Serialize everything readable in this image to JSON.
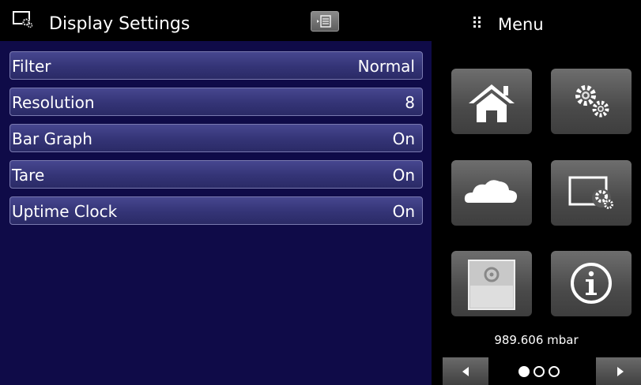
{
  "header": {
    "title": "Display Settings",
    "title_icon": "display-settings-icon",
    "collapse_icon": "collapse-panel-icon"
  },
  "settings": [
    {
      "label": "Filter",
      "value": "Normal"
    },
    {
      "label": "Resolution",
      "value": "8"
    },
    {
      "label": "Bar Graph",
      "value": "On"
    },
    {
      "label": "Tare",
      "value": "On"
    },
    {
      "label": "Uptime Clock",
      "value": "On"
    }
  ],
  "menu": {
    "title": "Menu",
    "grip_icon": "grip-icon",
    "tiles": [
      {
        "icon": "home-icon"
      },
      {
        "icon": "gears-icon"
      },
      {
        "icon": "cloud-icon"
      },
      {
        "icon": "display-settings-icon"
      },
      {
        "icon": "storage-icon"
      },
      {
        "icon": "info-icon"
      }
    ]
  },
  "footer": {
    "reading": "989.606 mbar",
    "pager": {
      "pages": 3,
      "current": 1
    },
    "prev_icon": "left-arrow-icon",
    "next_icon": "right-arrow-icon"
  },
  "colors": {
    "panel_background": "#0f0b48",
    "row_background": "#3a3a7e",
    "tile_background": "#5a5a5a"
  }
}
